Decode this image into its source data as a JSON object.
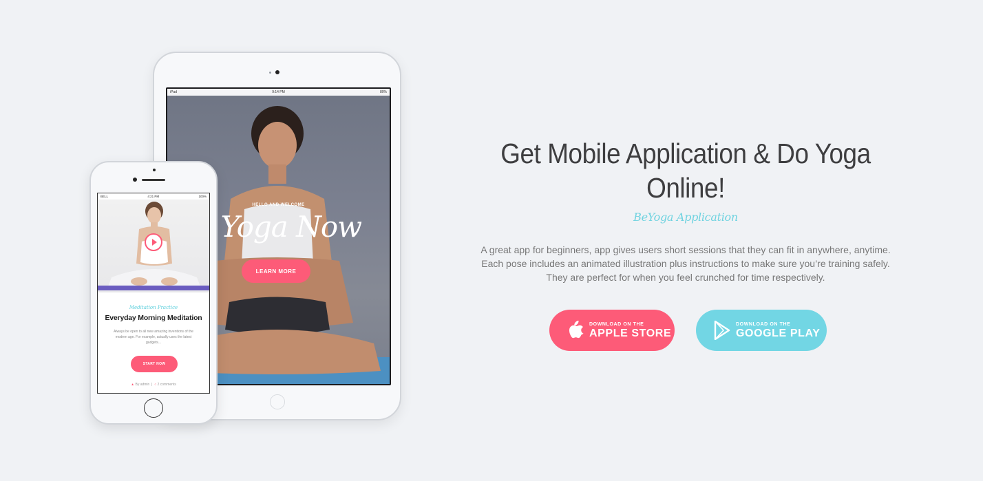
{
  "tablet": {
    "status_left": "iPad",
    "status_center": "9:14 PM",
    "status_right": "80%",
    "hello": "HELLO AND WELCOME",
    "big_title": "o Yoga Now",
    "learn_more": "LEARN MORE"
  },
  "phone": {
    "status_left": "BELL",
    "status_center": "4:21 PM",
    "status_right": "100%",
    "subtitle": "Meditation Practice",
    "title": "Everyday Morning Meditation",
    "text": "Always be open to all new amazing inventions of the modern age. For example, actually uses the latest gadgets...",
    "start_now": "START NOW",
    "author": "By admin",
    "comments": "2 comments"
  },
  "main": {
    "heading": "Get Mobile Application & Do Yoga Online!",
    "subheading": "BeYoga Application",
    "description": "A great app for beginners, app gives users short sessions that they can fit in anywhere, anytime. Each pose includes an animated illustration plus instructions to make sure you’re training safely. They are perfect for when you feel crunched for time respectively."
  },
  "buttons": {
    "apple": {
      "small": "DOWNLOAD ON THE",
      "big": "APPLE STORE",
      "icon": "apple-icon"
    },
    "google": {
      "small": "DOWNLOAD ON THE",
      "big": "GOOGLE PLAY",
      "icon": "play-icon"
    }
  },
  "colors": {
    "accent_pink": "#fd5b78",
    "accent_cyan": "#72d6e4",
    "background": "#f0f2f5"
  }
}
